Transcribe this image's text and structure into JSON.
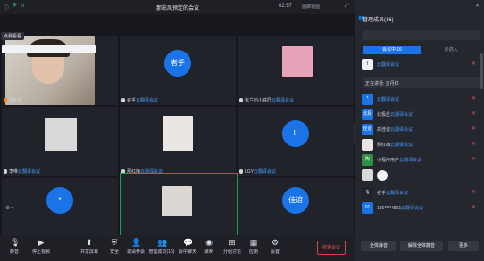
{
  "titlebar": {
    "title": "那影凤预定的会议",
    "time": "02:57",
    "view_label": "画廊视图"
  },
  "panel": {
    "title": "管理成员(16)",
    "search_placeholder": "",
    "tabs": [
      "会议中 16",
      "未进入"
    ],
    "tip": "正在讲话: 吉丹红",
    "members": [
      {
        "avatar": "f",
        "name": "",
        "role": "云翻译会议"
      },
      {
        "avatar": "",
        "name": "",
        "role": ""
      },
      {
        "avatar": "*",
        "name": "",
        "role": "云翻译会议"
      },
      {
        "avatar": "北极",
        "name": "北极星",
        "role": "云翻译会议"
      },
      {
        "avatar": "佳谊",
        "name": "高佳谊",
        "role": "云翻译会议"
      },
      {
        "avatar": "",
        "name": "那红梅",
        "role": "云翻译会议"
      },
      {
        "avatar": "陶",
        "name": "小程序用户",
        "role": "云翻译会议"
      },
      {
        "avatar": "",
        "name": "",
        "role": ""
      },
      {
        "avatar": "",
        "name": "者乎",
        "role": "云翻译会议"
      },
      {
        "avatar": "01",
        "name": "186****4501",
        "role": "云翻译会议"
      }
    ],
    "buttons": {
      "mute_all": "全体静音",
      "unmute_all": "解除全体静音",
      "more": "更多"
    }
  },
  "tiles": [
    {
      "name": "那影凤",
      "role": "",
      "avatar_text": ""
    },
    {
      "name": "者乎",
      "role": "云翻译会议",
      "avatar_text": "者乎"
    },
    {
      "name": "米兰的小铁匠",
      "role": "云翻译会议",
      "avatar_text": ""
    },
    {
      "name": "李唯",
      "role": "云翻译会议",
      "avatar_text": ""
    },
    {
      "name": "那红梅",
      "role": "云翻译会议",
      "avatar_text": ""
    },
    {
      "name": "LGY",
      "role": "云翻译会议",
      "avatar_text": "L"
    },
    {
      "name": "",
      "role": "",
      "avatar_text": "*"
    },
    {
      "name": "",
      "role": "",
      "avatar_text": ""
    },
    {
      "name": "",
      "role": "",
      "avatar_text": "佳谊"
    }
  ],
  "focus_badge": "点我看看",
  "toolbar": {
    "mute": "静音",
    "stop_video": "停止视频",
    "share": "共享屏幕",
    "security": "安全",
    "invite": "邀请参会",
    "members": "管理成员(16)",
    "chat": "会中聊天",
    "record": "录制",
    "breakout": "分组讨论",
    "apps": "应用",
    "settings": "设置",
    "end": "结束会议"
  },
  "colors": {
    "accent": "#1a74e8",
    "danger": "#e5413b"
  }
}
